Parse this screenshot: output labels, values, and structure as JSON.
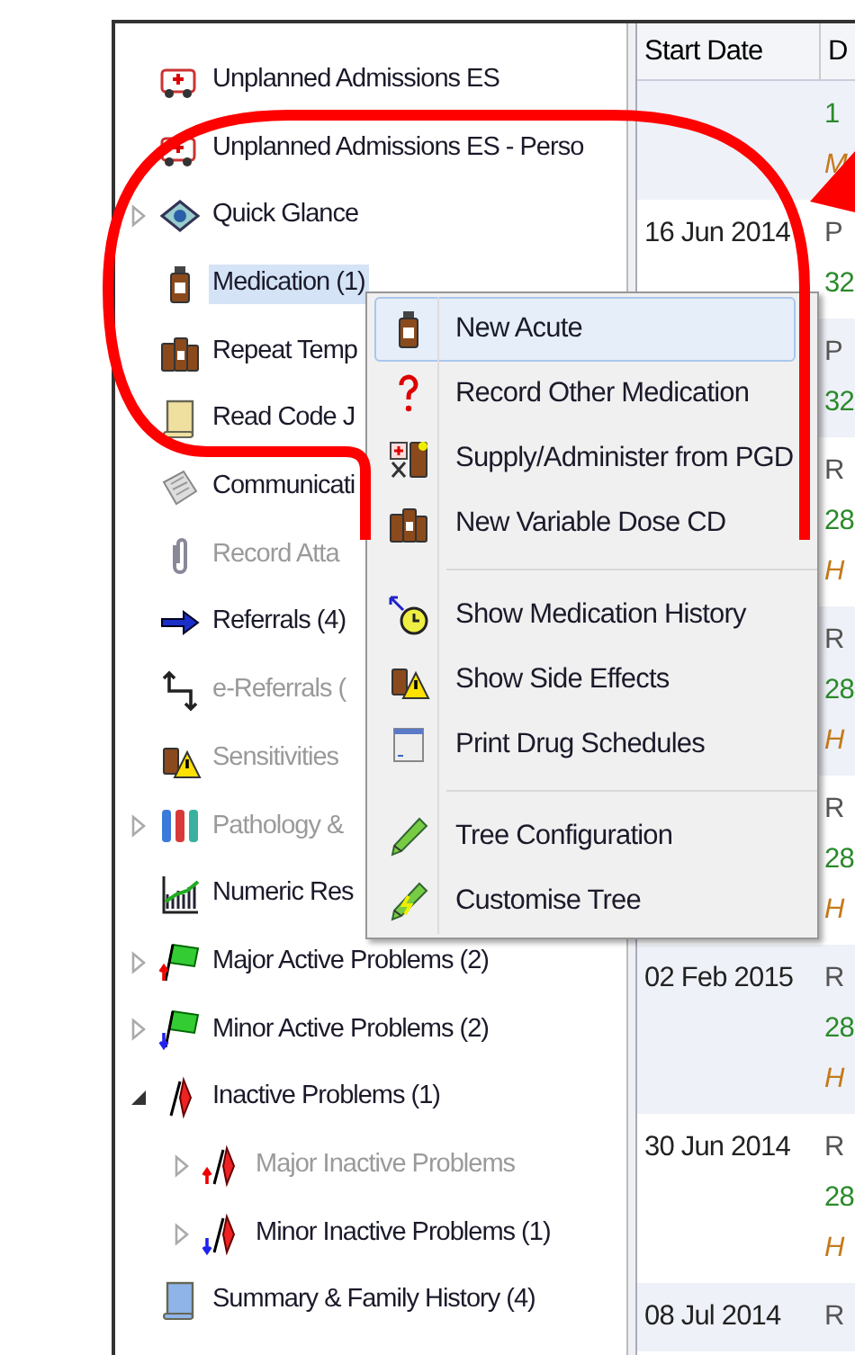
{
  "tree": {
    "items": [
      {
        "label": "Unplanned Admissions ES",
        "kind": "ambulance",
        "selected": false,
        "disabled": false
      },
      {
        "label": "Unplanned Admissions ES - Perso",
        "kind": "ambulance",
        "selected": false,
        "disabled": false
      },
      {
        "label": "Quick Glance",
        "kind": "eye",
        "selected": false,
        "disabled": false,
        "expanded": false
      },
      {
        "label": "Medication (1)",
        "kind": "bottle",
        "selected": true,
        "disabled": false
      },
      {
        "label": "Repeat Temp",
        "kind": "bottles",
        "selected": false,
        "disabled": false
      },
      {
        "label": "Read Code J",
        "kind": "scroll",
        "selected": false,
        "disabled": false
      },
      {
        "label": "Communicati",
        "kind": "letter",
        "selected": false,
        "disabled": false
      },
      {
        "label": "Record Atta",
        "kind": "clip",
        "selected": false,
        "disabled": true
      },
      {
        "label": "Referrals (4)",
        "kind": "arrow",
        "selected": false,
        "disabled": false
      },
      {
        "label": "e-Referrals (",
        "kind": "updown",
        "selected": false,
        "disabled": true
      },
      {
        "label": "Sensitivities",
        "kind": "warning",
        "selected": false,
        "disabled": true
      },
      {
        "label": "Pathology &",
        "kind": "tubes",
        "selected": false,
        "disabled": true,
        "expanded": false
      },
      {
        "label": "Numeric Res",
        "kind": "chart",
        "selected": false,
        "disabled": false
      },
      {
        "label": "Major Active Problems (2)",
        "kind": "flag-up",
        "selected": false,
        "disabled": false,
        "expanded": false
      },
      {
        "label": "Minor Active Problems (2)",
        "kind": "flag-down",
        "selected": false,
        "disabled": false,
        "expanded": false
      },
      {
        "label": "Inactive Problems (1)",
        "kind": "redflag",
        "selected": false,
        "disabled": false,
        "expanded": true,
        "children": [
          {
            "label": "Major Inactive Problems",
            "kind": "redflag-up",
            "selected": false,
            "disabled": true,
            "expanded": false
          },
          {
            "label": "Minor Inactive Problems (1)",
            "kind": "redflag-down",
            "selected": false,
            "disabled": false,
            "expanded": false
          }
        ]
      },
      {
        "label": "Summary & Family History (4)",
        "kind": "blue-scroll",
        "selected": false,
        "disabled": false
      }
    ]
  },
  "context_menu": {
    "groups": [
      [
        {
          "label": "New Acute",
          "kind": "bottle",
          "selected": true
        },
        {
          "label": "Record Other Medication",
          "kind": "question",
          "selected": false
        },
        {
          "label": "Supply/Administer from PGD",
          "kind": "supply",
          "selected": false
        },
        {
          "label": "New Variable Dose CD",
          "kind": "bottles",
          "selected": false
        }
      ],
      [
        {
          "label": "Show Medication History",
          "kind": "history",
          "selected": false
        },
        {
          "label": "Show Side Effects",
          "kind": "warning",
          "selected": false
        },
        {
          "label": "Print Drug Schedules",
          "kind": "window",
          "selected": false
        }
      ],
      [
        {
          "label": "Tree Configuration",
          "kind": "pencil",
          "selected": false
        },
        {
          "label": "Customise Tree",
          "kind": "pencil-bolt",
          "selected": false
        }
      ]
    ]
  },
  "table": {
    "columns": [
      "Start Date",
      "D"
    ],
    "rows": [
      {
        "date": "",
        "lines": [
          {
            "text": "1",
            "kind": "code"
          },
          {
            "text": "M",
            "kind": "term"
          }
        ]
      },
      {
        "date": "16 Jun 2014",
        "lines": [
          {
            "text": "P",
            "kind": "text"
          },
          {
            "text": "32",
            "kind": "code"
          }
        ]
      },
      {
        "date": "",
        "lines": [
          {
            "text": "P",
            "kind": "text"
          },
          {
            "text": "32",
            "kind": "code"
          }
        ]
      },
      {
        "date": "",
        "lines": [
          {
            "text": "R",
            "kind": "text"
          },
          {
            "text": "28",
            "kind": "code"
          },
          {
            "text": "H",
            "kind": "term"
          }
        ]
      },
      {
        "date": "",
        "lines": [
          {
            "text": "R",
            "kind": "text"
          },
          {
            "text": "28",
            "kind": "code"
          },
          {
            "text": "H",
            "kind": "term"
          }
        ]
      },
      {
        "date": "",
        "lines": [
          {
            "text": "R",
            "kind": "text"
          },
          {
            "text": "28",
            "kind": "code"
          },
          {
            "text": "H",
            "kind": "term"
          }
        ]
      },
      {
        "date": "02 Feb 2015",
        "lines": [
          {
            "text": "R",
            "kind": "text"
          },
          {
            "text": "28",
            "kind": "code"
          },
          {
            "text": "H",
            "kind": "term"
          }
        ]
      },
      {
        "date": "30 Jun 2014",
        "lines": [
          {
            "text": "R",
            "kind": "text"
          },
          {
            "text": "28",
            "kind": "code"
          },
          {
            "text": "H",
            "kind": "term"
          }
        ]
      },
      {
        "date": "08 Jul 2014",
        "lines": [
          {
            "text": "R",
            "kind": "text"
          }
        ]
      }
    ]
  }
}
